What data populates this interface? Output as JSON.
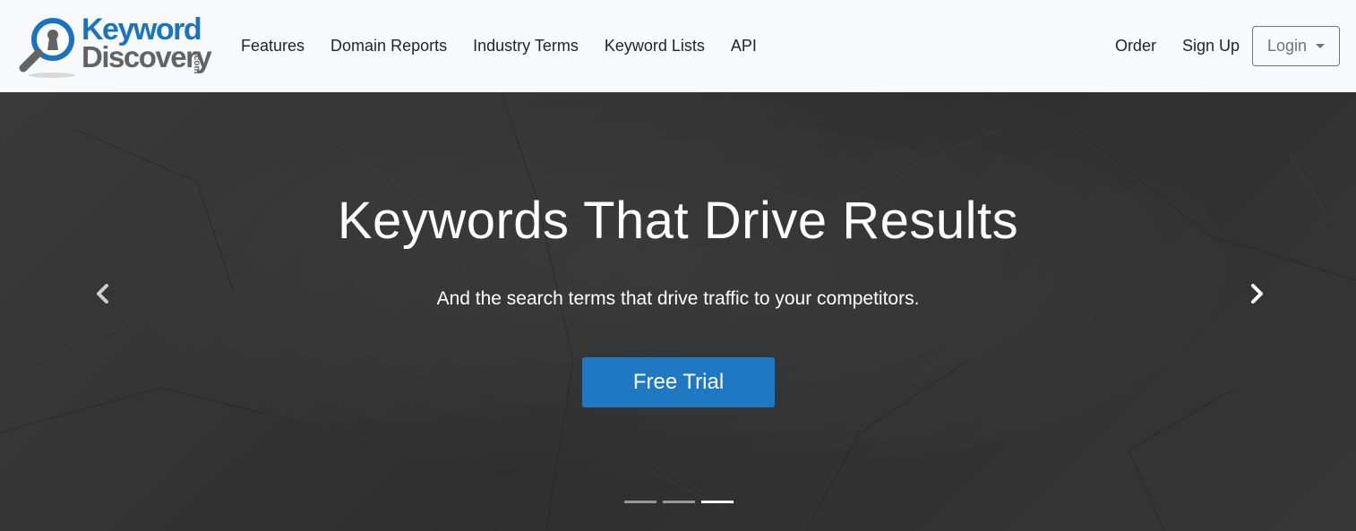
{
  "brand": {
    "word1": "Keyword",
    "word2": "Discovery",
    "tld": ".com",
    "colors": {
      "blue": "#1a73c0",
      "gray": "#636363"
    },
    "icon": "magnifier-keyhole-icon"
  },
  "nav": {
    "links": [
      "Features",
      "Domain Reports",
      "Industry Terms",
      "Keyword Lists",
      "API"
    ],
    "right_links": [
      "Order",
      "Sign Up"
    ],
    "login_label": "Login",
    "login_icon": "caret-down-icon"
  },
  "hero": {
    "title": "Keywords That Drive Results",
    "subtitle": "And the search terms that drive traffic to your competitors.",
    "cta_label": "Free Trial",
    "cta_color": "#1e78c2",
    "prev_icon": "chevron-left-icon",
    "next_icon": "chevron-right-icon",
    "slide_count": 3,
    "active_slide": 3
  }
}
